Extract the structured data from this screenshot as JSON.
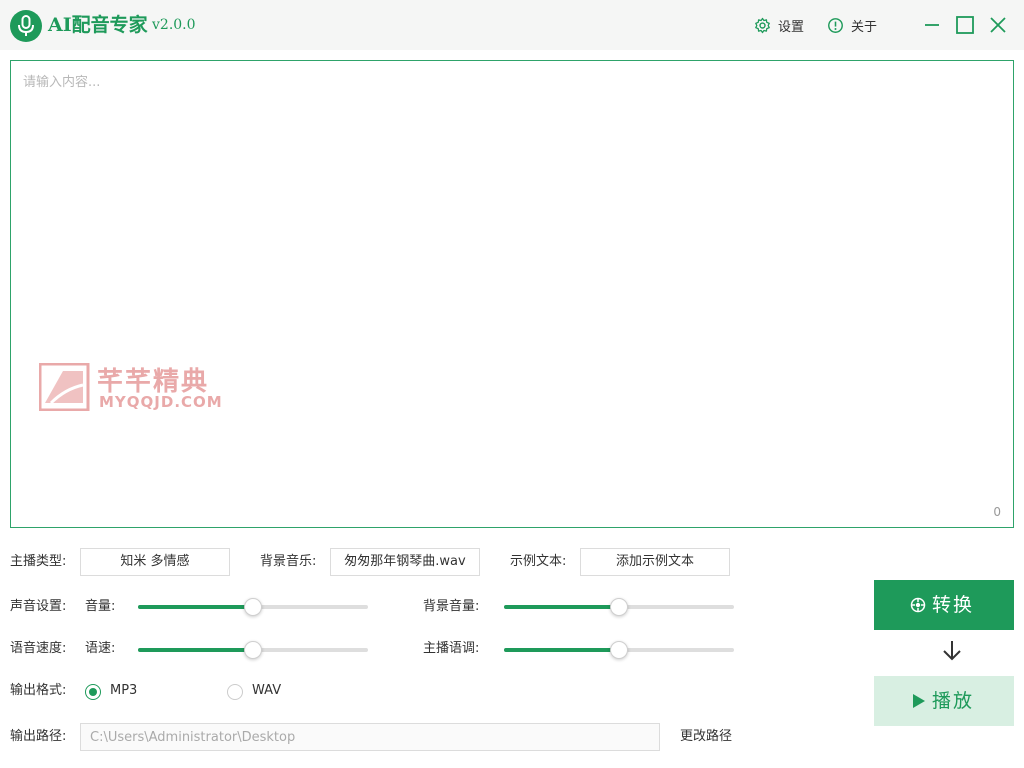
{
  "app": {
    "title": "AI配音专家",
    "version": "v2.0.0",
    "settings_label": "设置",
    "about_label": "关于",
    "accent_color": "#1e9a5a"
  },
  "editor": {
    "placeholder": "请输入内容...",
    "char_count": "0"
  },
  "watermark": {
    "text_cn": "芊芊精典",
    "text_en": "MYQQJD.COM"
  },
  "controls": {
    "anchor_type_label": "主播类型:",
    "anchor_type_value": "知米 多情感",
    "bg_music_label": "背景音乐:",
    "bg_music_value": "匆匆那年钢琴曲.wav",
    "sample_text_label": "示例文本:",
    "sample_text_button": "添加示例文本",
    "voice_settings_label": "声音设置:",
    "volume_label": "音量:",
    "volume_level": 0.5,
    "bg_volume_label": "背景音量:",
    "bg_volume_level": 0.5,
    "speech_speed_label": "语音速度:",
    "speed_label": "语速:",
    "speed_level": 0.5,
    "pitch_label": "主播语调:",
    "pitch_level": 0.5,
    "output_format_label": "输出格式:",
    "format_options": [
      "MP3",
      "WAV"
    ],
    "format_selected": "MP3",
    "output_path_label": "输出路径:",
    "output_path_value": "C:\\Users\\Administrator\\Desktop",
    "change_path_label": "更改路径"
  },
  "actions": {
    "convert_label": "转换",
    "play_label": "播放"
  },
  "icons": {
    "logo": "microphone-icon",
    "settings": "gear-icon",
    "about": "info-icon",
    "minimize": "minimize-icon",
    "maximize": "maximize-icon",
    "close": "close-icon",
    "convert": "spinner-icon",
    "play": "play-icon",
    "arrow": "arrow-down-icon"
  }
}
